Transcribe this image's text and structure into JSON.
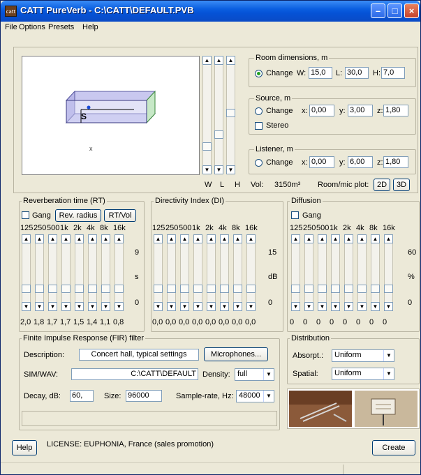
{
  "window": {
    "title": "CATT PureVerb - C:\\CATT\\DEFAULT.PVB",
    "app_icon": "catt"
  },
  "menu": [
    "File",
    "Options",
    "Presets",
    "Help"
  ],
  "room": {
    "group_label": "Room dimensions, m",
    "change": "Change",
    "w_label": "W:",
    "w": "15,0",
    "l_label": "L:",
    "l": "30,0",
    "h_label": "H:",
    "h": "7,0"
  },
  "source": {
    "group_label": "Source, m",
    "change": "Change",
    "x_label": "x:",
    "x": "0,00",
    "y_label": "y:",
    "y": "3,00",
    "z_label": "z:",
    "z": "1,80",
    "stereo": "Stereo"
  },
  "listener": {
    "group_label": "Listener, m",
    "change": "Change",
    "x_label": "x:",
    "x": "0,00",
    "y_label": "y:",
    "y": "6,00",
    "z_label": "z:",
    "z": "1,80"
  },
  "dim_sliders": {
    "labels": [
      "W",
      "L",
      "H"
    ],
    "levels": [
      0.16,
      0.29,
      0.53
    ]
  },
  "room_info": {
    "vol_label": "Vol:",
    "vol_value": "3150m³",
    "plot_label": "Room/mic plot:",
    "btn2d": "2D",
    "btn3d": "3D"
  },
  "view3d": {
    "source_mark": "S",
    "receiver_mark": "x"
  },
  "rt": {
    "group_label": "Reverberation time (RT)",
    "gang": "Gang",
    "rev_radius": "Rev. radius",
    "rt_vol": "RT/Vol",
    "freqs": [
      "125",
      "250",
      "500",
      "1k",
      "2k",
      "4k",
      "8k",
      "16k"
    ],
    "values": [
      "2,0",
      "1,8",
      "1,7",
      "1,7",
      "1,5",
      "1,4",
      "1,1",
      "0,8"
    ],
    "scale_top": "9",
    "scale_unit": "s",
    "scale_bottom": "0"
  },
  "di": {
    "group_label": "Directivity Index (DI)",
    "freqs": [
      "125",
      "250",
      "500",
      "1k",
      "2k",
      "4k",
      "8k",
      "16k"
    ],
    "values": [
      "0,0",
      "0,0",
      "0,0",
      "0,0",
      "0,0",
      "0,0",
      "0,0",
      "0,0"
    ],
    "scale_top": "15",
    "scale_unit": "dB",
    "scale_bottom": "0"
  },
  "diffusion": {
    "group_label": "Diffusion",
    "gang": "Gang",
    "freqs": [
      "125",
      "250",
      "500",
      "1k",
      "2k",
      "4k",
      "8k",
      "16k"
    ],
    "values": [
      "0",
      "0",
      "0",
      "0",
      "0",
      "0",
      "0",
      "0"
    ],
    "scale_top": "60",
    "scale_unit": "%",
    "scale_bottom": "0"
  },
  "fir": {
    "group_label": "Finite Impulse Response (FIR) filter",
    "description_label": "Description:",
    "description": "Concert hall, typical settings",
    "microphones": "Microphones...",
    "simwav_label": "SIM/WAV:",
    "simwav": "C:\\CATT\\DEFAULT",
    "density_label": "Density:",
    "density": "full",
    "decay_label": "Decay, dB:",
    "decay": "60,",
    "size_label": "Size:",
    "size": "96000",
    "samplerate_label": "Sample-rate, Hz:",
    "samplerate": "48000"
  },
  "distribution": {
    "group_label": "Distribution",
    "absorpt_label": "Absorpt.:",
    "absorpt": "Uniform",
    "spatial_label": "Spatial:",
    "spatial": "Uniform"
  },
  "bottom": {
    "help": "Help",
    "license": "LICENSE: EUPHONIA, France (sales promotion)",
    "create": "Create"
  }
}
